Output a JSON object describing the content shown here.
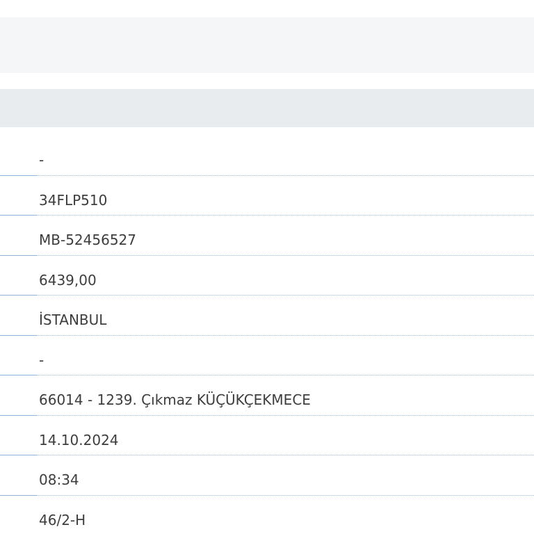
{
  "rows": [
    {
      "value": "-"
    },
    {
      "value": "34FLP510"
    },
    {
      "value": "MB-52456527"
    },
    {
      "value": "6439,00"
    },
    {
      "value": "İSTANBUL"
    },
    {
      "value": "-"
    },
    {
      "value": "66014 - 1239. Çıkmaz KÜÇÜKÇEKMECE"
    },
    {
      "value": "14.10.2024"
    },
    {
      "value": "08:34"
    },
    {
      "value": "46/2-H"
    }
  ]
}
